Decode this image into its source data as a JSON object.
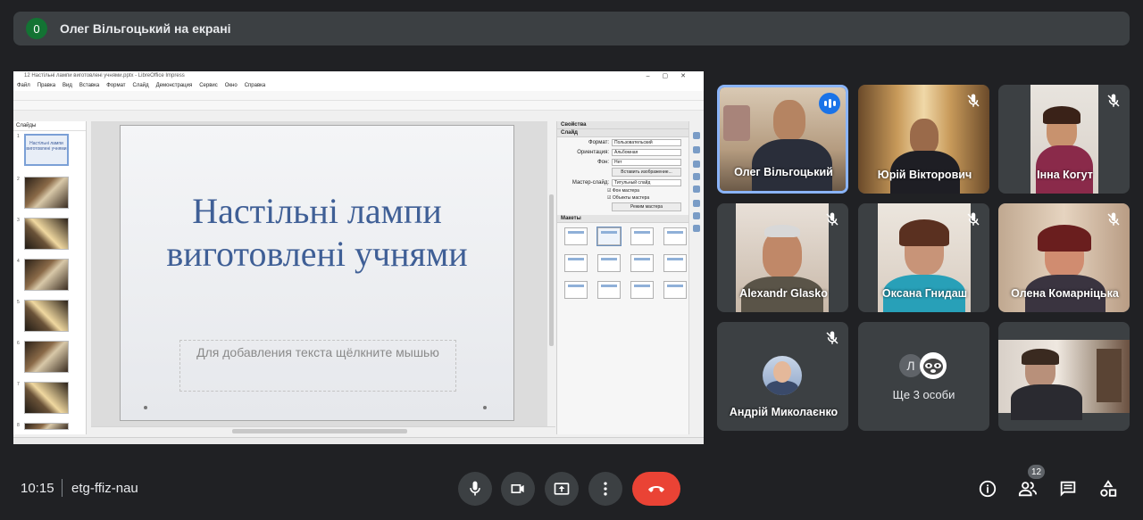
{
  "banner": {
    "presenter_count": "0",
    "title": "Олег Вільгоцький на екрані"
  },
  "shared_screen": {
    "window_title": "12 Настільні лампи виготовлені учнями.pptx - LibreOffice Impress",
    "menu": [
      "Файл",
      "Правка",
      "Вид",
      "Вставка",
      "Формат",
      "Слайд",
      "Демонстрация",
      "Сервис",
      "Окно",
      "Справка"
    ],
    "slides_pane_title": "Слайды",
    "slide_numbers": [
      "1",
      "2",
      "3",
      "4",
      "5",
      "6",
      "7",
      "8"
    ],
    "thumb1_text": "Настільні лампи виготовлені учнями",
    "slide_title": "Настільні лампи виготовлені учнями",
    "slide_subtitle_placeholder": "Для добавления текста щёлкните мышью",
    "props": {
      "title": "Свойства",
      "section_slide": "Слайд",
      "format_label": "Формат:",
      "format_value": "Пользовательский",
      "orientation_label": "Ориентация:",
      "orientation_value": "Альбомная",
      "bg_label": "Фон:",
      "bg_value": "Нет",
      "insert_image": "Вставить изображение...",
      "master_label": "Мастер-слайд:",
      "master_value": "Титульный слайд",
      "chk_master_bg": "Фон мастера",
      "chk_master_obj": "Объекты мастера",
      "master_mode": "Режим мастера",
      "section_layouts": "Макеты"
    }
  },
  "participants": [
    {
      "name": "Олег Вільгоцький",
      "speaking": true
    },
    {
      "name": "Юрій Вікторович",
      "muted": true
    },
    {
      "name": "Інна Когут",
      "muted": true
    },
    {
      "name": "Alexandr Glasko",
      "muted": true
    },
    {
      "name": "Оксана Гнидаш",
      "muted": true
    },
    {
      "name": "Олена Комарніцька",
      "muted": true
    },
    {
      "name": "Андрій Миколаєнко",
      "muted": true
    },
    {
      "name": "",
      "muted": false
    }
  ],
  "more_people": {
    "initial": "Л",
    "label": "Ще 3 особи"
  },
  "bottom_bar": {
    "time": "10:15",
    "meeting_code": "etg-ffiz-nau",
    "people_count": "12"
  },
  "colors": {
    "background": "#202124",
    "tile": "#3c4043",
    "end_call": "#ea4335",
    "active_border": "#8ab4f8",
    "presenter_badge": "#137333"
  }
}
